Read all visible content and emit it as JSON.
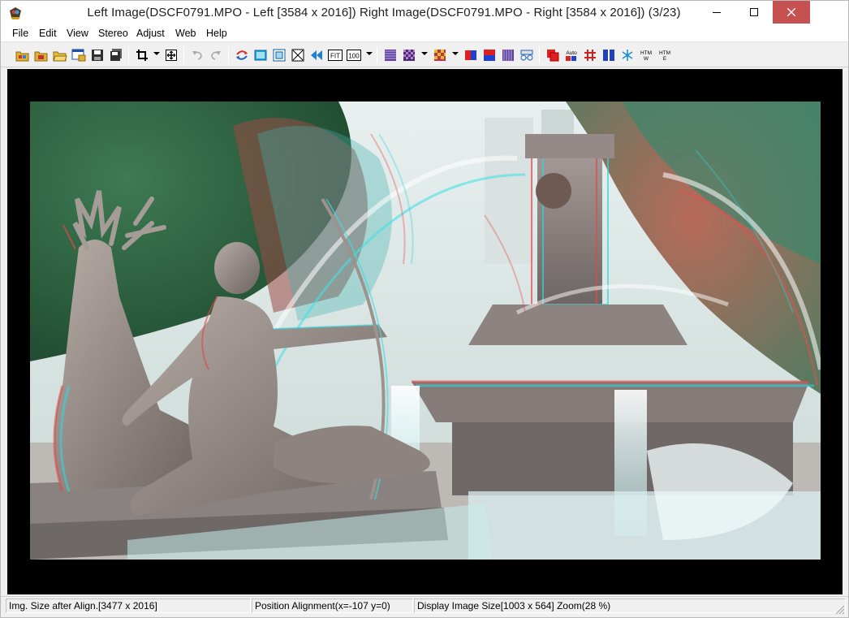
{
  "window": {
    "title": "Left Image(DSCF0791.MPO - Left [3584 x 2016]) Right Image(DSCF0791.MPO - Right [3584 x 2016])  (3/23)"
  },
  "menu": {
    "items": [
      {
        "label": "File"
      },
      {
        "label": "Edit"
      },
      {
        "label": "View"
      },
      {
        "label": "Stereo"
      },
      {
        "label": "Adjust"
      },
      {
        "label": "Web"
      },
      {
        "label": "Help"
      }
    ]
  },
  "toolbar": {
    "fit_label": "FIT",
    "zoom100_label": "100",
    "auto_label": "Auto",
    "htm_w_label": "HTM",
    "htm_w_sub": "W",
    "htm_e_label": "HTM",
    "htm_e_sub": "E"
  },
  "status": {
    "img_size": "Img. Size after Align.[3477 x 2016]",
    "position": "Position Alignment(x=-107 y=0)",
    "display": "Display Image Size[1003 x 564]  Zoom(28 %)"
  },
  "colors": {
    "close_button": "#c75050",
    "viewport_bg": "#000000",
    "anaglyph_red": "#e0404a",
    "anaglyph_cyan": "#30d8e0"
  }
}
